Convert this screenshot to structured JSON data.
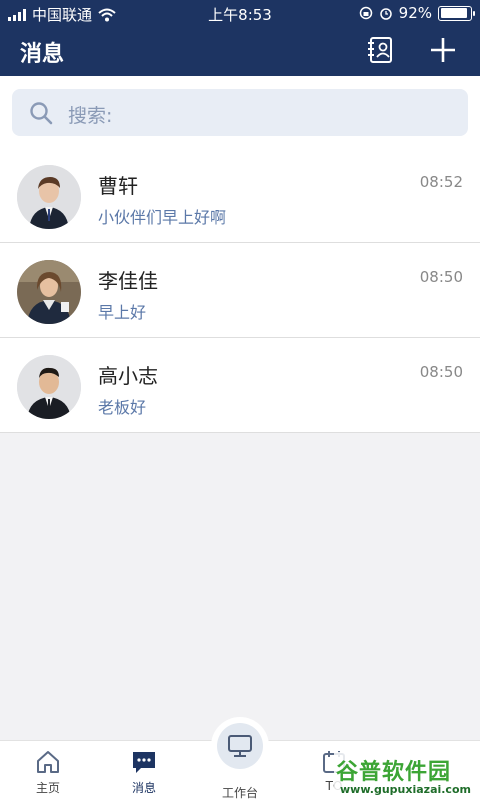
{
  "status_bar": {
    "carrier": "中国联通",
    "time": "上午8:53",
    "battery_text": "92%",
    "battery_level": 0.92
  },
  "header": {
    "title": "消息",
    "icons": [
      "contacts-icon",
      "plus-icon"
    ]
  },
  "search": {
    "placeholder": "搜索:"
  },
  "conversations": [
    {
      "name": "曹轩",
      "preview": "小伙伴们早上好啊",
      "time": "08:52"
    },
    {
      "name": "李佳佳",
      "preview": "早上好",
      "time": "08:50"
    },
    {
      "name": "高小志",
      "preview": "老板好",
      "time": "08:50"
    }
  ],
  "tabbar": {
    "tabs": [
      {
        "label": "主页",
        "icon": "home-icon"
      },
      {
        "label": "消息",
        "icon": "message-icon",
        "active": true
      },
      {
        "label": "工作台",
        "icon": "monitor-icon"
      },
      {
        "label": "TO",
        "icon": "calendar-icon"
      }
    ]
  },
  "watermark": {
    "title": "谷普软件园",
    "url": "www.gupuxiazai.com"
  },
  "colors": {
    "header_bg": "#1d3462",
    "preview_text": "#5b78a8",
    "search_bg": "#e8edf5",
    "watermark_green": "#3ca535"
  }
}
